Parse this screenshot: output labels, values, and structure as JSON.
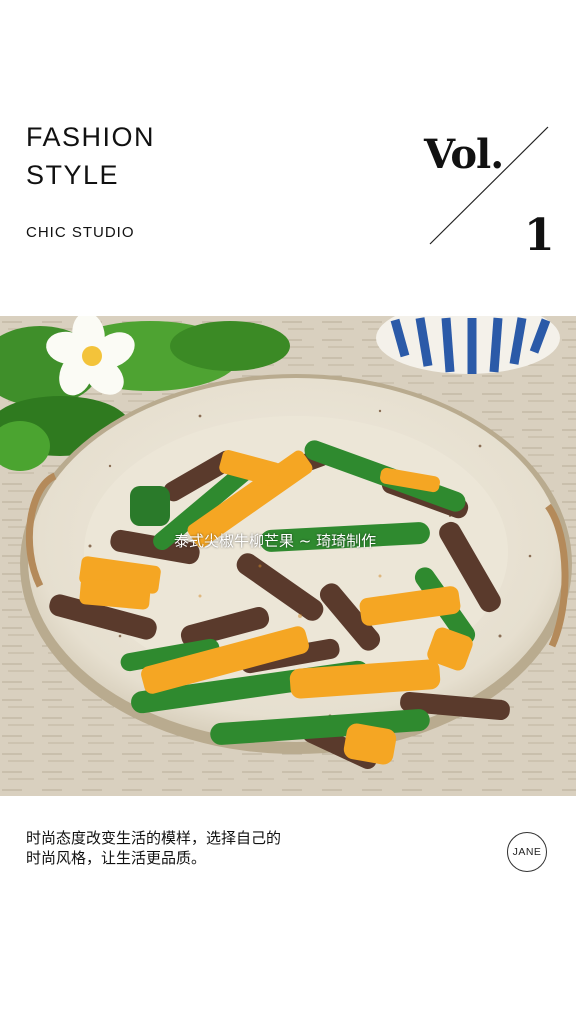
{
  "header": {
    "title_line1": "FASHION",
    "title_line2": "STYLE",
    "studio": "CHIC STUDIO",
    "vol_label": "Vol.",
    "vol_number": "1"
  },
  "photo": {
    "caption": "泰式尖椒牛柳芒果 ~ 琦琦制作",
    "subject": "stir-fried beef with green peppers and mango on a speckled ceramic plate"
  },
  "footer": {
    "tagline_line1": "时尚态度改变生活的模样，选择自己的",
    "tagline_line2": "时尚风格，让生活更品质。",
    "badge": "JANE"
  },
  "colors": {
    "background": "#ffffff",
    "text": "#111111",
    "plate": "#ebe5d6",
    "beef": "#5a3a2c",
    "pepper": "#2f7a2f",
    "mango": "#f5a623"
  }
}
